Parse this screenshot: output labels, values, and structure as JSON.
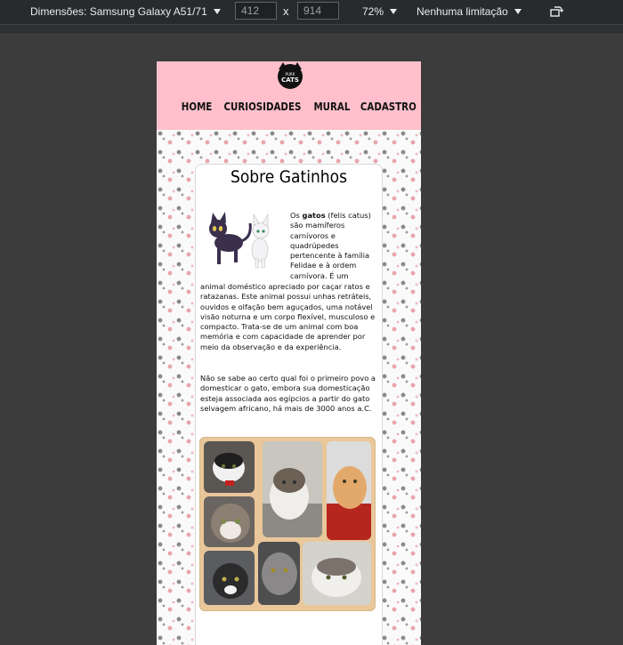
{
  "devtools": {
    "device_label": "Dimensões: Samsung Galaxy A51/71",
    "width_value": "412",
    "height_value": "914",
    "times_symbol": "x",
    "zoom_label": "72%",
    "throttle_label": "Nenhuma limitação",
    "rotate_icon": "rotate-icon"
  },
  "site": {
    "logo_small": "PURR",
    "logo_big": "CATS",
    "nav": [
      "HOME",
      "CURIOSIDADES",
      "MURAL",
      "CADASTRO"
    ]
  },
  "card": {
    "title": "Sobre Gatinhos",
    "p1_intro": "Os ",
    "p1_bold": "gatos",
    "p1_right_rest": " (felis catus) são mamíferos carnívoros e quadrúpedes pertencente à família Felidae e à ordem carnívora. É um",
    "p1_full": "animal doméstico apreciado por caçar ratos e ratazanas. Este animal possui unhas retráteis, ouvidos e olfação bem aguçados, uma notável visão noturna e um corpo flexível, musculoso e compacto. Trata-se de um animal com boa memória e com capacidade de aprender por meio da observação e da experiência.",
    "p2": "Não se sabe ao certo qual foi o primeiro povo a domesticar o gato, embora sua domesticação esteja associada aos egípcios a partir do gato selvagem africano, há mais de 3000 anos a.C."
  },
  "colors": {
    "header_pink": "#ffc0cb",
    "collage_frame": "#e9c79a",
    "devtools_bg": "#292a2d"
  }
}
